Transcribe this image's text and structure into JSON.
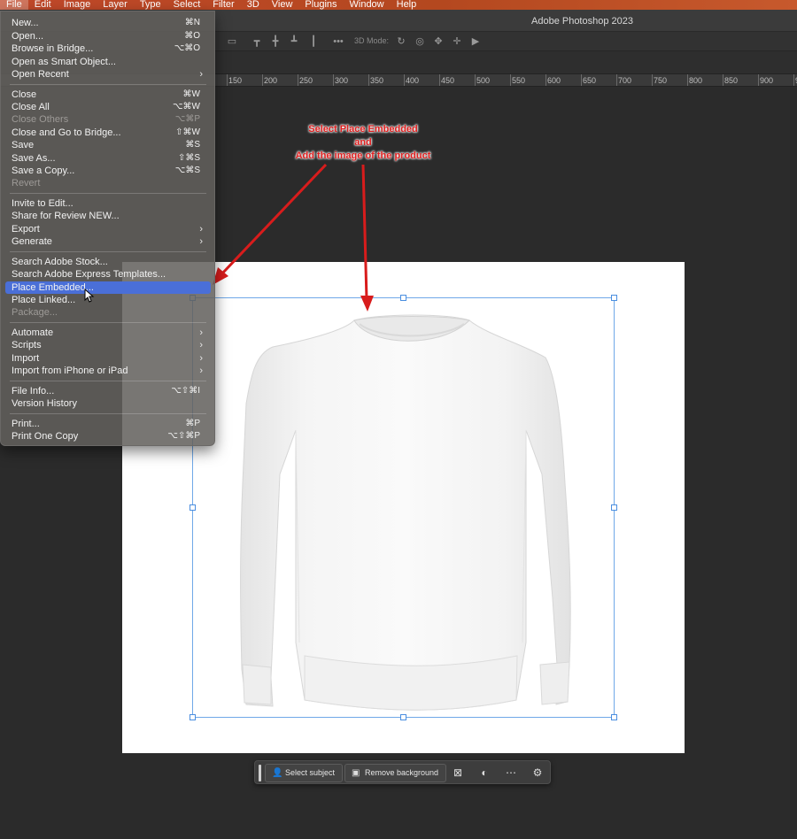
{
  "menubar": {
    "items": [
      "File",
      "Edit",
      "Image",
      "Layer",
      "Type",
      "Select",
      "Filter",
      "3D",
      "View",
      "Plugins",
      "Window",
      "Help"
    ]
  },
  "window": {
    "title": "Adobe Photoshop 2023"
  },
  "options_bar": {
    "mode_label": "3D Mode:"
  },
  "ruler": {
    "labels": [
      "150",
      "200",
      "250",
      "300",
      "350",
      "400",
      "450",
      "500",
      "550",
      "600",
      "650",
      "700",
      "750",
      "800",
      "850",
      "900",
      "95"
    ]
  },
  "file_menu": {
    "items": [
      {
        "label": "New...",
        "shortcut": "⌘N"
      },
      {
        "label": "Open...",
        "shortcut": "⌘O"
      },
      {
        "label": "Browse in Bridge...",
        "shortcut": "⌥⌘O"
      },
      {
        "label": "Open as Smart Object...",
        "shortcut": ""
      },
      {
        "label": "Open Recent",
        "shortcut": ""
      },
      {
        "label": "Close",
        "shortcut": "⌘W"
      },
      {
        "label": "Close All",
        "shortcut": "⌥⌘W"
      },
      {
        "label": "Close Others",
        "shortcut": "⌥⌘P"
      },
      {
        "label": "Close and Go to Bridge...",
        "shortcut": "⇧⌘W"
      },
      {
        "label": "Save",
        "shortcut": "⌘S"
      },
      {
        "label": "Save As...",
        "shortcut": "⇧⌘S"
      },
      {
        "label": "Save a Copy...",
        "shortcut": "⌥⌘S"
      },
      {
        "label": "Revert",
        "shortcut": ""
      },
      {
        "label": "Invite to Edit...",
        "shortcut": ""
      },
      {
        "label": "Share for Review NEW...",
        "shortcut": ""
      },
      {
        "label": "Export",
        "shortcut": ""
      },
      {
        "label": "Generate",
        "shortcut": ""
      },
      {
        "label": "Search Adobe Stock...",
        "shortcut": ""
      },
      {
        "label": "Search Adobe Express Templates...",
        "shortcut": ""
      },
      {
        "label": "Place Embedded...",
        "shortcut": ""
      },
      {
        "label": "Place Linked...",
        "shortcut": ""
      },
      {
        "label": "Package...",
        "shortcut": ""
      },
      {
        "label": "Automate",
        "shortcut": ""
      },
      {
        "label": "Scripts",
        "shortcut": ""
      },
      {
        "label": "Import",
        "shortcut": ""
      },
      {
        "label": "Import from iPhone or iPad",
        "shortcut": ""
      },
      {
        "label": "File Info...",
        "shortcut": "⌥⇧⌘I"
      },
      {
        "label": "Version History",
        "shortcut": ""
      },
      {
        "label": "Print...",
        "shortcut": "⌘P"
      },
      {
        "label": "Print One Copy",
        "shortcut": "⌥⇧⌘P"
      }
    ]
  },
  "annotation": {
    "line1": "Select Place Embedded",
    "line2": "and",
    "line3": "Add the image of the product"
  },
  "taskbar": {
    "select_subject": "Select subject",
    "remove_background": "Remove background"
  },
  "colors": {
    "highlight": "#4a6fd8",
    "annotation": "#e02020",
    "selection": "#6fa8e8"
  }
}
